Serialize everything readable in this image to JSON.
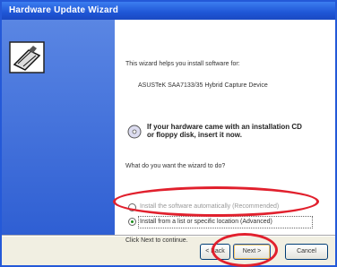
{
  "window": {
    "title": "Hardware Update Wizard"
  },
  "wizard": {
    "intro": "This wizard helps you install software for:",
    "device": "ASUSTeK SAA7133/35 Hybrid Capture Device",
    "cd_hint_line1": "If your hardware came with an installation CD",
    "cd_hint_line2": "or floppy disk, insert it now.",
    "question": "What do you want the wizard to do?",
    "option_auto": "Install the software automatically (Recommended)",
    "option_manual": "Install from a list or specific location (Advanced)",
    "footer_hint": "Click Next to continue."
  },
  "buttons": {
    "back": "< Back",
    "next": "Next >",
    "cancel": "Cancel"
  },
  "colors": {
    "title_bar": "#1f56d6",
    "side_panel": "#3f6fdc",
    "highlight_circle": "#e1202d"
  }
}
